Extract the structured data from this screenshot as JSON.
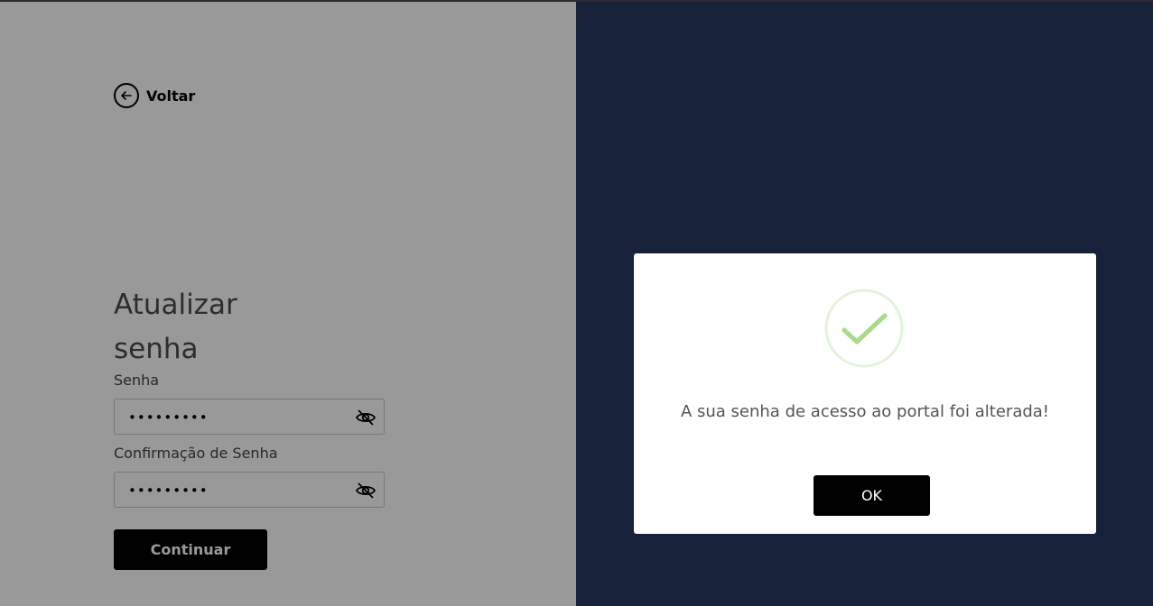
{
  "back": {
    "label": "Voltar",
    "icon": "arrow-left-icon"
  },
  "form": {
    "title_line1": "Atualizar",
    "title_line2": "senha",
    "password_label": "Senha",
    "password_value": "•••••••••",
    "confirm_label": "Confirmação de Senha",
    "confirm_value": "•••••••••",
    "submit_label": "Continuar"
  },
  "modal": {
    "message": "A sua senha de acesso ao portal foi alterada!",
    "ok_label": "OK",
    "icon": "check-circle-icon",
    "check_color": "#a5dc86"
  },
  "colors": {
    "right_panel": "#27375f",
    "button": "#000000"
  }
}
